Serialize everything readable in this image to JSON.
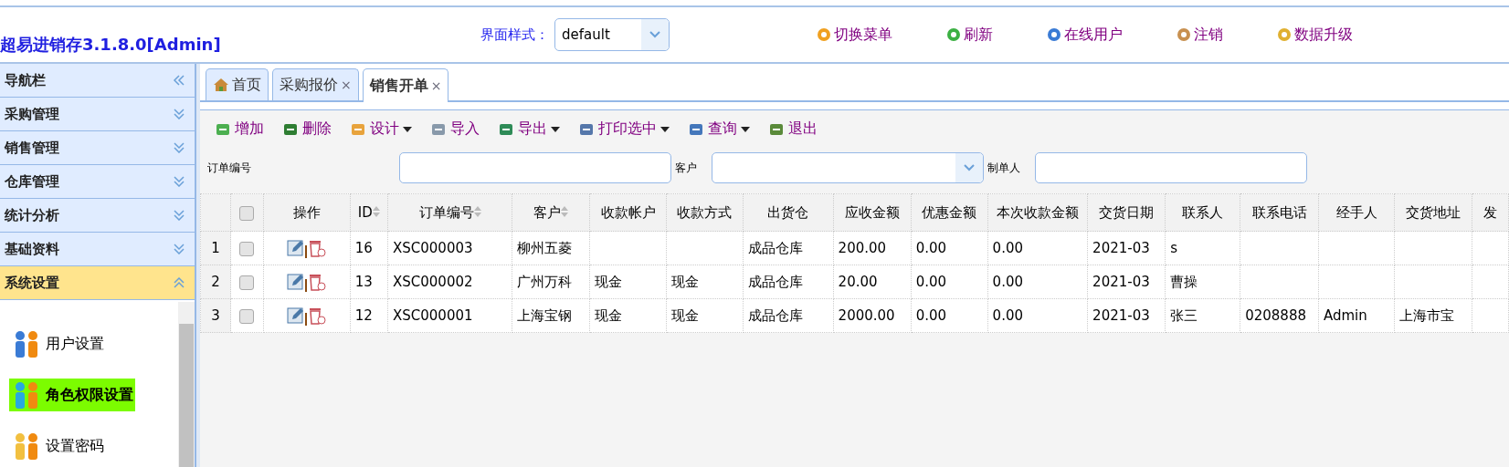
{
  "header": {
    "title": "超易进销存3.1.8.0[Admin]",
    "style_label": "界面样式：",
    "style_value": "default",
    "actions": [
      {
        "label": "切换菜单"
      },
      {
        "label": "刷新"
      },
      {
        "label": "在线用户"
      },
      {
        "label": "注销"
      },
      {
        "label": "数据升级"
      }
    ]
  },
  "sidebar": {
    "title": "导航栏",
    "sections": [
      {
        "label": "采购管理",
        "expanded": false
      },
      {
        "label": "销售管理",
        "expanded": false
      },
      {
        "label": "仓库管理",
        "expanded": false
      },
      {
        "label": "统计分析",
        "expanded": false
      },
      {
        "label": "基础资料",
        "expanded": false
      },
      {
        "label": "系统设置",
        "expanded": true
      }
    ],
    "items": [
      {
        "label": "用户设置",
        "selected": false
      },
      {
        "label": "角色权限设置",
        "selected": true
      },
      {
        "label": "设置密码",
        "selected": false
      }
    ]
  },
  "tabs": [
    {
      "label": "首页",
      "selected": false
    },
    {
      "label": "采购报价",
      "close": "×",
      "selected": false
    },
    {
      "label": "销售开单",
      "close": "×",
      "selected": true
    }
  ],
  "toolbar": [
    {
      "label": "增加",
      "dropdown": false
    },
    {
      "label": "删除",
      "dropdown": false
    },
    {
      "label": "设计",
      "dropdown": true
    },
    {
      "label": "导入",
      "dropdown": false
    },
    {
      "label": "导出",
      "dropdown": true
    },
    {
      "label": "打印选中",
      "dropdown": true
    },
    {
      "label": "查询",
      "dropdown": true
    },
    {
      "label": "退出",
      "dropdown": false
    }
  ],
  "filters": [
    {
      "label": "订单编号",
      "kind": "text"
    },
    {
      "label": "客户",
      "kind": "combo"
    },
    {
      "label": "制单人",
      "kind": "text"
    }
  ],
  "table": {
    "all_checked": false,
    "columns": [
      {
        "label": "操作",
        "sortable": false
      },
      {
        "label": "ID",
        "sortable": true
      },
      {
        "label": "订单编号",
        "sortable": true
      },
      {
        "label": "客户",
        "sortable": true
      },
      {
        "label": "收款帐户",
        "sortable": false
      },
      {
        "label": "收款方式",
        "sortable": false
      },
      {
        "label": "出货仓",
        "sortable": false
      },
      {
        "label": "应收金额",
        "sortable": false
      },
      {
        "label": "优惠金额",
        "sortable": false
      },
      {
        "label": "本次收款金额",
        "sortable": false
      },
      {
        "label": "交货日期",
        "sortable": false
      },
      {
        "label": "联系人",
        "sortable": false
      },
      {
        "label": "联系电话",
        "sortable": false
      },
      {
        "label": "经手人",
        "sortable": false
      },
      {
        "label": "交货地址",
        "sortable": false
      },
      {
        "label": "发",
        "sortable": false
      }
    ],
    "rows": [
      {
        "num": "1",
        "checked": false,
        "cells": [
          "",
          "16",
          "XSC000003",
          "柳州五菱",
          "",
          "",
          "成品仓库",
          "200.00",
          "0.00",
          "0.00",
          "2021-03",
          "s",
          "",
          "",
          "",
          ""
        ]
      },
      {
        "num": "2",
        "checked": false,
        "cells": [
          "",
          "13",
          "XSC000002",
          "广州万科",
          "现金",
          "现金",
          "成品仓库",
          "20.00",
          "0.00",
          "0.00",
          "2021-03",
          "曹操",
          "",
          "",
          "",
          ""
        ]
      },
      {
        "num": "3",
        "checked": false,
        "cells": [
          "",
          "12",
          "XSC000001",
          "上海宝钢",
          "现金",
          "现金",
          "成品仓库",
          "2000.00",
          "0.00",
          "0.00",
          "2021-03",
          "张三",
          "0208888",
          "Admin",
          "上海市宝",
          ""
        ]
      }
    ]
  }
}
